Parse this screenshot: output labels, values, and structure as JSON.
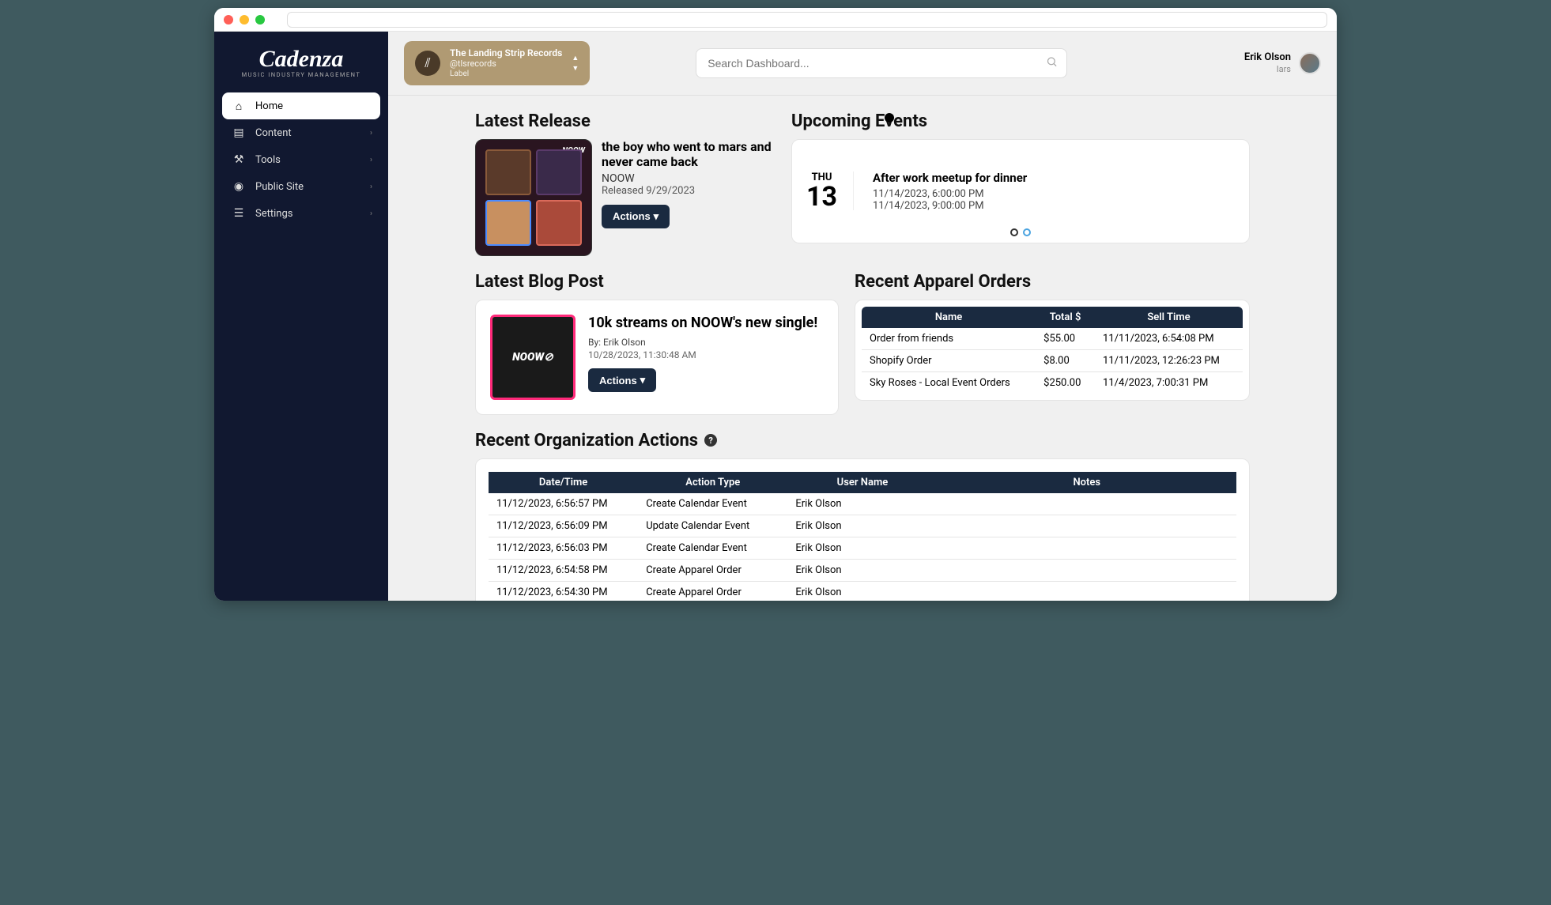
{
  "brand": {
    "name": "Cadenza",
    "tagline": "MUSIC INDUSTRY MANAGEMENT"
  },
  "nav": {
    "home": "Home",
    "content": "Content",
    "tools": "Tools",
    "public_site": "Public Site",
    "settings": "Settings"
  },
  "org": {
    "name": "The Landing Strip Records",
    "handle": "@tlsrecords",
    "type": "Label"
  },
  "search": {
    "placeholder": "Search Dashboard..."
  },
  "user": {
    "name": "Erik Olson",
    "handle": "lars"
  },
  "latest_release": {
    "heading": "Latest Release",
    "title": "the boy who went to mars and never came back",
    "artist": "NOOW",
    "released": "Released 9/29/2023",
    "actions": "Actions"
  },
  "upcoming_events": {
    "heading": "Upcoming Events",
    "day_name": "THU",
    "day_num": "13",
    "title": "After work meetup for dinner",
    "start": "11/14/2023, 6:00:00 PM",
    "end": "11/14/2023, 9:00:00 PM"
  },
  "latest_blog": {
    "heading": "Latest Blog Post",
    "thumb_text": "NOOW⊘",
    "title": "10k streams on NOOW's new single!",
    "author": "By: Erik Olson",
    "date": "10/28/2023, 11:30:48 AM",
    "actions": "Actions"
  },
  "apparel_orders": {
    "heading": "Recent Apparel Orders",
    "headers": {
      "name": "Name",
      "total": "Total $",
      "sell_time": "Sell Time"
    },
    "rows": [
      {
        "name": "Order from friends",
        "total": "$55.00",
        "time": "11/11/2023, 6:54:08 PM"
      },
      {
        "name": "Shopify Order",
        "total": "$8.00",
        "time": "11/11/2023, 12:26:23 PM"
      },
      {
        "name": "Sky Roses - Local Event Orders",
        "total": "$250.00",
        "time": "11/4/2023, 7:00:31 PM"
      }
    ]
  },
  "org_actions": {
    "heading": "Recent Organization Actions",
    "headers": {
      "dt": "Date/Time",
      "type": "Action Type",
      "user": "User Name",
      "notes": "Notes"
    },
    "rows": [
      {
        "dt": "11/12/2023, 6:56:57 PM",
        "type": "Create Calendar Event",
        "user": "Erik Olson",
        "notes": ""
      },
      {
        "dt": "11/12/2023, 6:56:09 PM",
        "type": "Update Calendar Event",
        "user": "Erik Olson",
        "notes": ""
      },
      {
        "dt": "11/12/2023, 6:56:03 PM",
        "type": "Create Calendar Event",
        "user": "Erik Olson",
        "notes": ""
      },
      {
        "dt": "11/12/2023, 6:54:58 PM",
        "type": "Create Apparel Order",
        "user": "Erik Olson",
        "notes": ""
      },
      {
        "dt": "11/12/2023, 6:54:30 PM",
        "type": "Create Apparel Order",
        "user": "Erik Olson",
        "notes": ""
      }
    ]
  }
}
